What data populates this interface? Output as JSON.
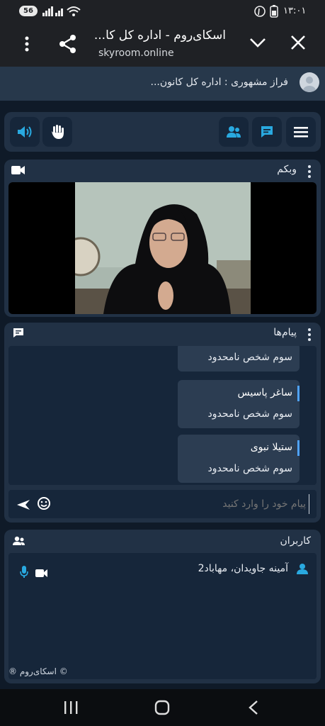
{
  "status_bar": {
    "battery": "56",
    "time": "۱۳:۰۱"
  },
  "browser": {
    "title": "اسکای‌روم - اداره کل کا...",
    "url": "skyroom.online"
  },
  "announcement": {
    "text": "فراز مشهوری : اداره کل کانون..."
  },
  "webcam_panel": {
    "title": "وبکم"
  },
  "messages_panel": {
    "title": "پیام‌ها",
    "messages": [
      {
        "sender": "",
        "text": "سوم شخص نامحدود"
      },
      {
        "sender": "ساغر پاسیس",
        "text": "سوم شخص نامحدود"
      },
      {
        "sender": "ستیلا نبوی",
        "text": "سوم شخص نامحدود"
      }
    ],
    "input_placeholder": "پیام خود را وارد کنید"
  },
  "users_panel": {
    "title": "کاربران",
    "users": [
      {
        "name": "آمینه جاویدان، مهاباد2"
      }
    ]
  },
  "footer": {
    "copyright": "© اسکای‌روم ®"
  },
  "colors": {
    "accent": "#29a9e0",
    "panel": "#213145",
    "background": "#0f1a28"
  }
}
